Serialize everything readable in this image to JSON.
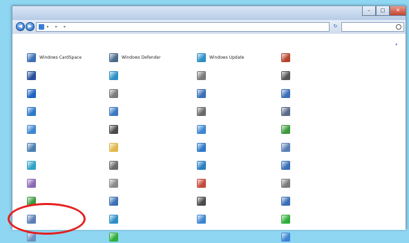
{
  "window": {
    "minimize_glyph": "–",
    "maximize_glyph": "□",
    "close_glyph": "✕"
  },
  "nav": {
    "back_glyph": "◀",
    "forward_glyph": "▶",
    "refresh_glyph": "↻",
    "breadcrumbs": [
      "",
      "",
      ""
    ],
    "separator": "▸",
    "search_placeholder": ""
  },
  "header": {
    "heading": "",
    "view_by_label": "",
    "view_by_value": "",
    "caret": "▾"
  },
  "items": [
    {
      "label": "Windows CardSpace",
      "icon": "cardspace-icon",
      "color": "#3b6fb6"
    },
    {
      "label": "",
      "icon": "action-center-flag-icon",
      "color": "#2a4f9a"
    },
    {
      "label": "",
      "icon": "ease-of-access-icon",
      "color": "#1f63c2"
    },
    {
      "label": "",
      "icon": "display-icon",
      "color": "#2e79c9"
    },
    {
      "label": "",
      "icon": "troubleshooting-icon",
      "color": "#3d86d1"
    },
    {
      "label": "",
      "icon": "performance-icon",
      "color": "#4a7fb0"
    },
    {
      "label": "",
      "icon": "homegroup-icon",
      "color": "#2fa3c7"
    },
    {
      "label": "",
      "icon": "location-sensor-icon",
      "color": "#8a6bb5"
    },
    {
      "label": "",
      "icon": "default-programs-icon",
      "color": "#3d9a3d"
    },
    {
      "label": "",
      "icon": "user-icon",
      "color": "#5b7fb5"
    },
    {
      "label": "",
      "icon": "sound-region-icon",
      "color": "#6b8fc2"
    },
    {
      "label": "Windows Defender",
      "icon": "defender-icon",
      "color": "#4a6a8a"
    },
    {
      "label": "",
      "icon": "internet-options-icon",
      "color": "#2e8fc7"
    },
    {
      "label": "",
      "icon": "sound-icon",
      "color": "#7a7a7a"
    },
    {
      "label": "",
      "icon": "desktop-gadgets-icon",
      "color": "#3b77c2"
    },
    {
      "label": "",
      "icon": "keyboard-icon",
      "color": "#4a4a4a"
    },
    {
      "label": "",
      "icon": "folder-options-icon",
      "color": "#e0b84a"
    },
    {
      "label": "",
      "icon": "mouse-icon",
      "color": "#6a6a6a"
    },
    {
      "label": "",
      "icon": "phone-modem-icon",
      "color": "#8a8a8a"
    },
    {
      "label": "",
      "icon": "credential-manager-icon",
      "color": "#3b6fb6"
    },
    {
      "label": "",
      "icon": "region-language-icon",
      "color": "#2e8fc7"
    },
    {
      "label": "",
      "icon": "sync-center-icon",
      "color": "#2fae3a"
    },
    {
      "label": "Windows Update",
      "icon": "windows-update-icon",
      "color": "#2e8fc7"
    },
    {
      "label": "",
      "icon": "indexing-options-icon",
      "color": "#7a7a7a"
    },
    {
      "label": "",
      "icon": "system-icon",
      "color": "#3b6fb6"
    },
    {
      "label": "",
      "icon": "device-manager-icon",
      "color": "#6a6a6a"
    },
    {
      "label": "",
      "icon": "network-sharing-icon",
      "color": "#3d86d1"
    },
    {
      "label": "",
      "icon": "fonts-icon",
      "color": "#2e79c9"
    },
    {
      "label": "",
      "icon": "mail-icon",
      "color": "#2a7fc0"
    },
    {
      "label": "",
      "icon": "color-management-icon",
      "color": "#c44a3a"
    },
    {
      "label": "",
      "icon": "notification-area-icon",
      "color": "#4a4a4a"
    },
    {
      "label": "",
      "icon": "getting-started-icon",
      "color": "#3d86d1"
    },
    {
      "label": "",
      "icon": "windows-firewall-icon",
      "color": "#b5452e"
    },
    {
      "label": "",
      "icon": "keyboard-icon",
      "color": "#555555"
    },
    {
      "label": "",
      "icon": "taskbar-start-icon",
      "color": "#3b6fb6"
    },
    {
      "label": "",
      "icon": "devices-printers-icon",
      "color": "#5a6a8a"
    },
    {
      "label": "",
      "icon": "backup-restore-icon",
      "color": "#3d9a3d"
    },
    {
      "label": "",
      "icon": "programs-features-icon",
      "color": "#5b7fb5"
    },
    {
      "label": "",
      "icon": "user-accounts-icon",
      "color": "#3b6fb6"
    },
    {
      "label": "",
      "icon": "admin-tools-icon",
      "color": "#7a7a7a"
    },
    {
      "label": "",
      "icon": "date-time-icon",
      "color": "#3b6fb6"
    },
    {
      "label": "",
      "icon": "power-options-icon",
      "color": "#2fae3a"
    },
    {
      "label": "",
      "icon": "parental-controls-icon",
      "color": "#3d86d1"
    }
  ]
}
